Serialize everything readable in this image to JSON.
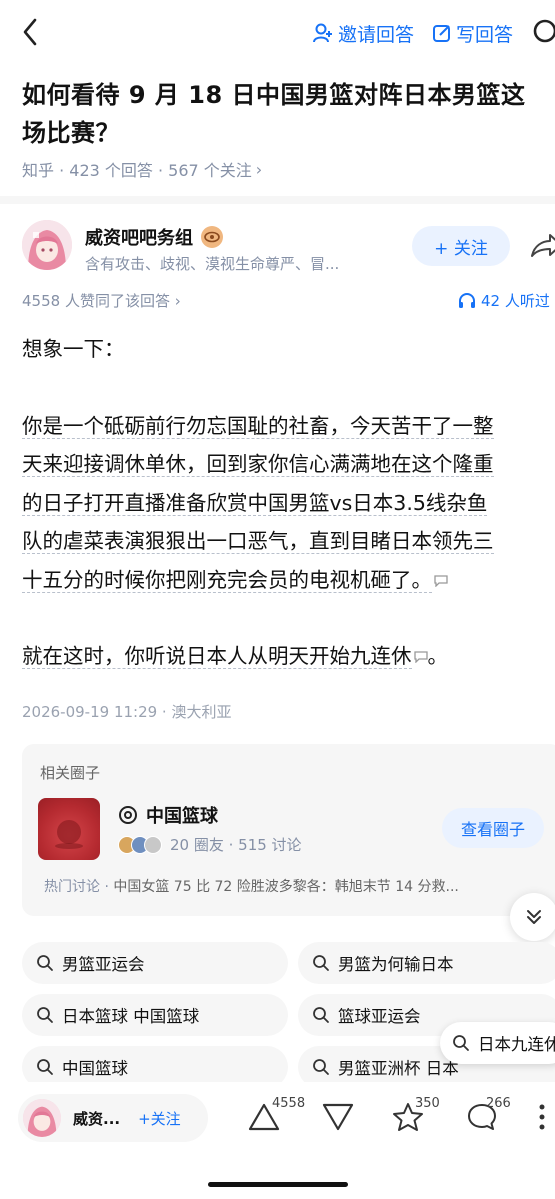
{
  "topbar": {
    "invite_label": "邀请回答",
    "write_label": "写回答"
  },
  "question": {
    "title": "如何看待 9 月 18 日中国男篮对阵日本男篮这场比赛？",
    "meta_source": "知乎 · 423 个回答 · 567 个关注",
    "meta_arrow": "›"
  },
  "author": {
    "name": "威资吧吧务组",
    "desc": "含有攻击、歧视、漠视生命尊严、冒...",
    "follow_label": "+ 关注"
  },
  "stats": {
    "agree": "4558 人赞同了该回答 ›",
    "listen": "42 人听过"
  },
  "content": {
    "p1": "想象一下：",
    "p2_lines": [
      "你是一个砥砺前行勿忘国耻的社畜，今天苦干了一整",
      "天来迎接调休单休，回到家你信心满满地在这个隆重",
      "的日子打开直播准备欣赏中国男篮vs日本3.5线杂鱼",
      "队的虐菜表演狠狠出一口恶气，直到目睹日本领先三",
      "十五分的时候你把刚充完会员的电视机砸了。"
    ],
    "p3": "就在这时，你听说日本人从明天开始九连休",
    "p3_end": "。"
  },
  "pub_meta": "2026-09-19 11:29 · 澳大利亚",
  "circle": {
    "section_title": "相关圈子",
    "name": "中国篮球",
    "stats": "20 圈友 · 515 讨论",
    "view_label": "查看圈子",
    "hot_label": "热门讨论 · ",
    "hot_text": "中国女篮 75 比 72 险胜波多黎各：韩旭末节 14 分救..."
  },
  "chips": [
    "男篮亚运会",
    "男篮为何输日本",
    "日本篮球 中国篮球",
    "篮球亚运会",
    "中国篮球",
    "男篮亚洲杯 日本"
  ],
  "chip_float": "日本九连休",
  "bottom": {
    "name": "威资...",
    "follow_label": "+关注",
    "upvote_count": "4558",
    "star_count": "350",
    "comment_count": "266"
  },
  "colors": {
    "accent": "#1772f6",
    "accent_bg": "#eaf2ff",
    "muted": "#8590a6"
  }
}
